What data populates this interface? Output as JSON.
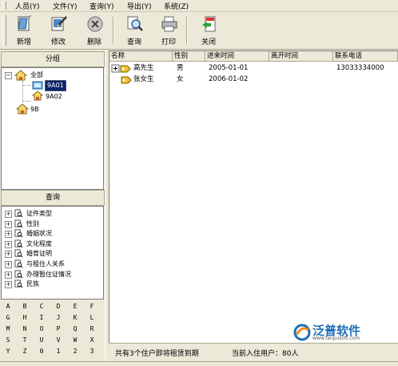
{
  "menu": [
    "人员(Y)",
    "文件(Y)",
    "查询(Y)",
    "导出(Y)",
    "系统(Z)"
  ],
  "toolbar": {
    "add": "新增",
    "edit": "修改",
    "delete": "删除",
    "query": "查询",
    "print": "打印",
    "close": "关闭"
  },
  "group_panel": {
    "title": "分组",
    "tree": {
      "root": "全部",
      "children": [
        "9A01",
        "9A02"
      ],
      "sibling": "9B"
    }
  },
  "query_panel": {
    "title": "查询",
    "items": [
      "证件类型",
      "性别",
      "婚姻状况",
      "文化程度",
      "婚育证明",
      "与租住人关系",
      "办理暂住证情况",
      "民族"
    ]
  },
  "alphabet_rows": [
    [
      "A",
      "B",
      "C",
      "D",
      "E",
      "F"
    ],
    [
      "G",
      "H",
      "I",
      "J",
      "K",
      "L"
    ],
    [
      "M",
      "N",
      "O",
      "P",
      "Q",
      "R"
    ],
    [
      "S",
      "T",
      "U",
      "V",
      "W",
      "X"
    ],
    [
      "Y",
      "Z",
      "0",
      "1",
      "2",
      "3"
    ]
  ],
  "grid": {
    "columns": [
      "名称",
      "性别",
      "进来时间",
      "离开时间",
      "联系电话"
    ],
    "rows": [
      {
        "name": "高先生",
        "gender": "男",
        "in": "2005-01-01",
        "out": "",
        "phone": "13033334000"
      },
      {
        "name": "张女生",
        "gender": "女",
        "in": "2006-01-02",
        "out": "",
        "phone": ""
      }
    ]
  },
  "status": {
    "left": "共有3个住户即将租赁到期",
    "right": "当前入住用户：80人"
  },
  "watermark": {
    "brand": "泛普软件",
    "url": "www.fanpusoft.com"
  },
  "colors": {
    "chrome": "#ece9d8",
    "selection": "#0a246a",
    "brand_blue": "#1d6fb8",
    "brand_orange": "#f08a24"
  }
}
